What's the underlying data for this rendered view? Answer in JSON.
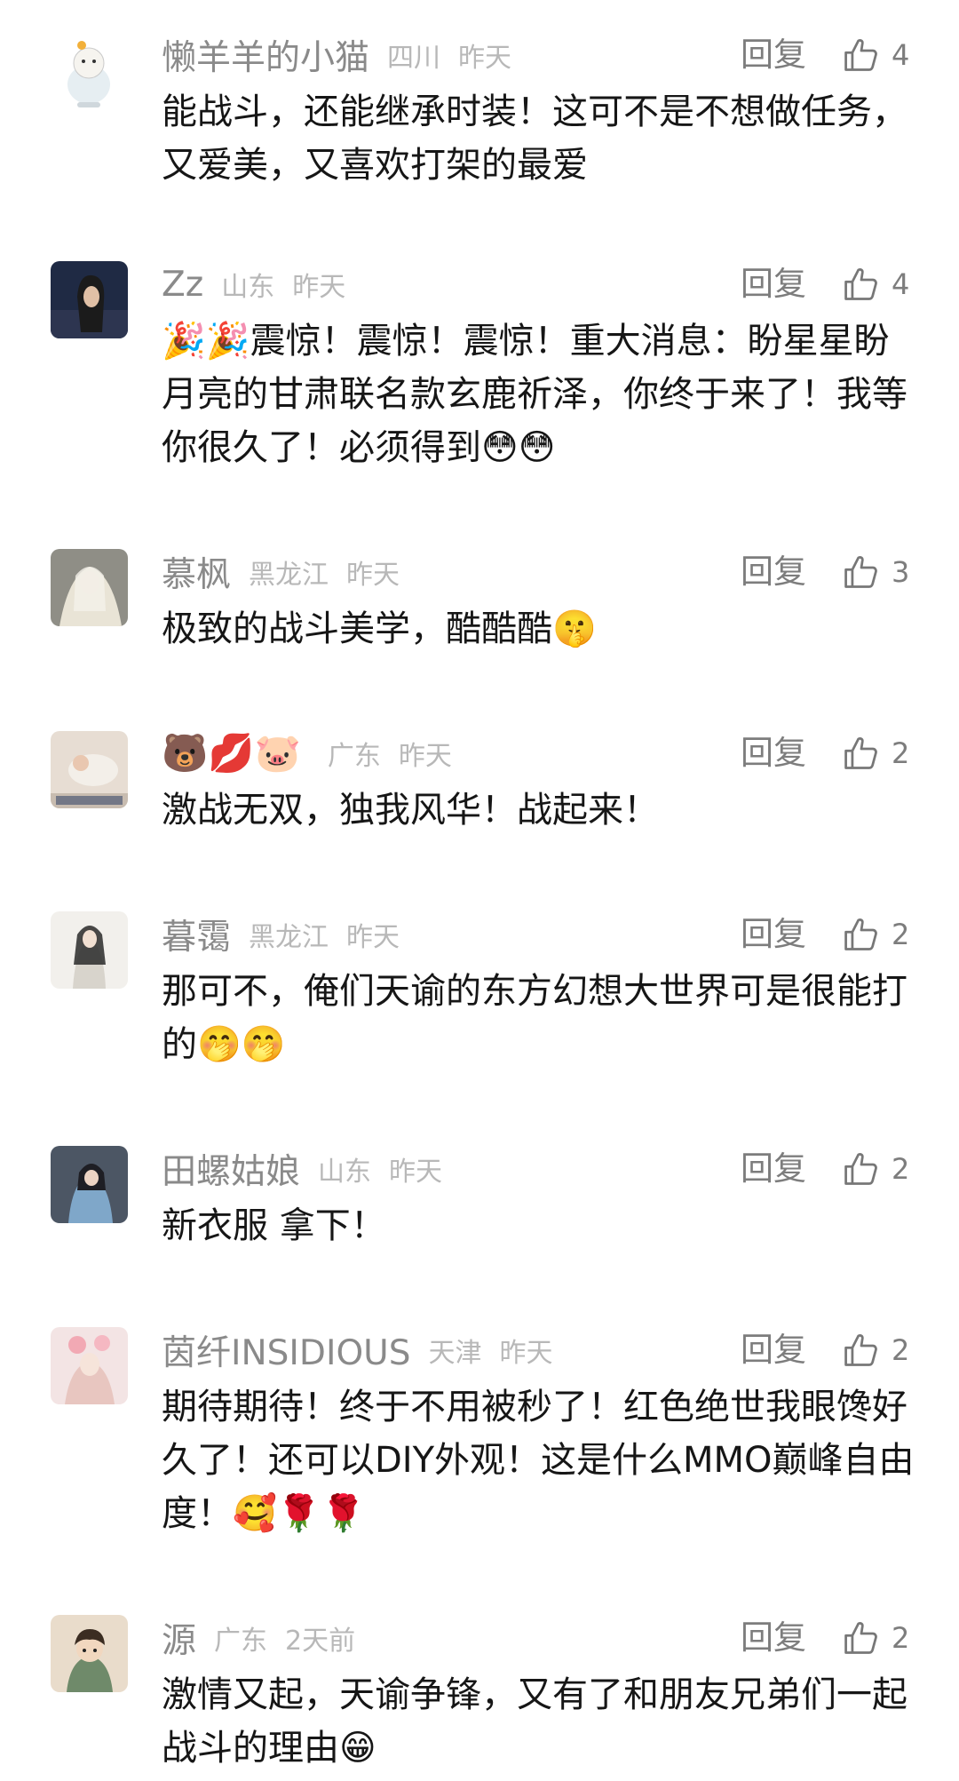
{
  "ui": {
    "reply_label": "回复"
  },
  "comments": [
    {
      "name": "懒羊羊的小猫",
      "region": "四川",
      "time": "昨天",
      "likes": "4",
      "text": "能战斗，还能继承时装！这可不是不想做任务，又爱美，又喜欢打架的最爱"
    },
    {
      "name": "Zz",
      "region": "山东",
      "time": "昨天",
      "likes": "4",
      "text": "🎉🎉震惊！震惊！震惊！重大消息：盼星星盼月亮的甘肃联名款玄鹿祈泽，你终于来了！我等你很久了！必须得到😳😳"
    },
    {
      "name": "慕枫",
      "region": "黑龙江",
      "time": "昨天",
      "likes": "3",
      "text": "极致的战斗美学，酷酷酷🤫"
    },
    {
      "name": "🐻💋🐷",
      "region": "广东",
      "time": "昨天",
      "likes": "2",
      "text": "激战无双，独我风华！战起来！"
    },
    {
      "name": "暮霭",
      "region": "黑龙江",
      "time": "昨天",
      "likes": "2",
      "text": "那可不，俺们天谕的东方幻想大世界可是很能打的🤭🤭"
    },
    {
      "name": "田螺姑娘",
      "region": "山东",
      "time": "昨天",
      "likes": "2",
      "text": "新衣服 拿下！"
    },
    {
      "name": "茵纤INSIDIOUS",
      "region": "天津",
      "time": "昨天",
      "likes": "2",
      "text": "期待期待！终于不用被秒了！红色绝世我眼馋好久了！还可以DIY外观！这是什么MMO巅峰自由度！🥰🌹🌹"
    },
    {
      "name": "源",
      "region": "广东",
      "time": "2天前",
      "likes": "2",
      "text": "激情又起，天谕争锋，又有了和朋友兄弟们一起战斗的理由😁"
    }
  ]
}
